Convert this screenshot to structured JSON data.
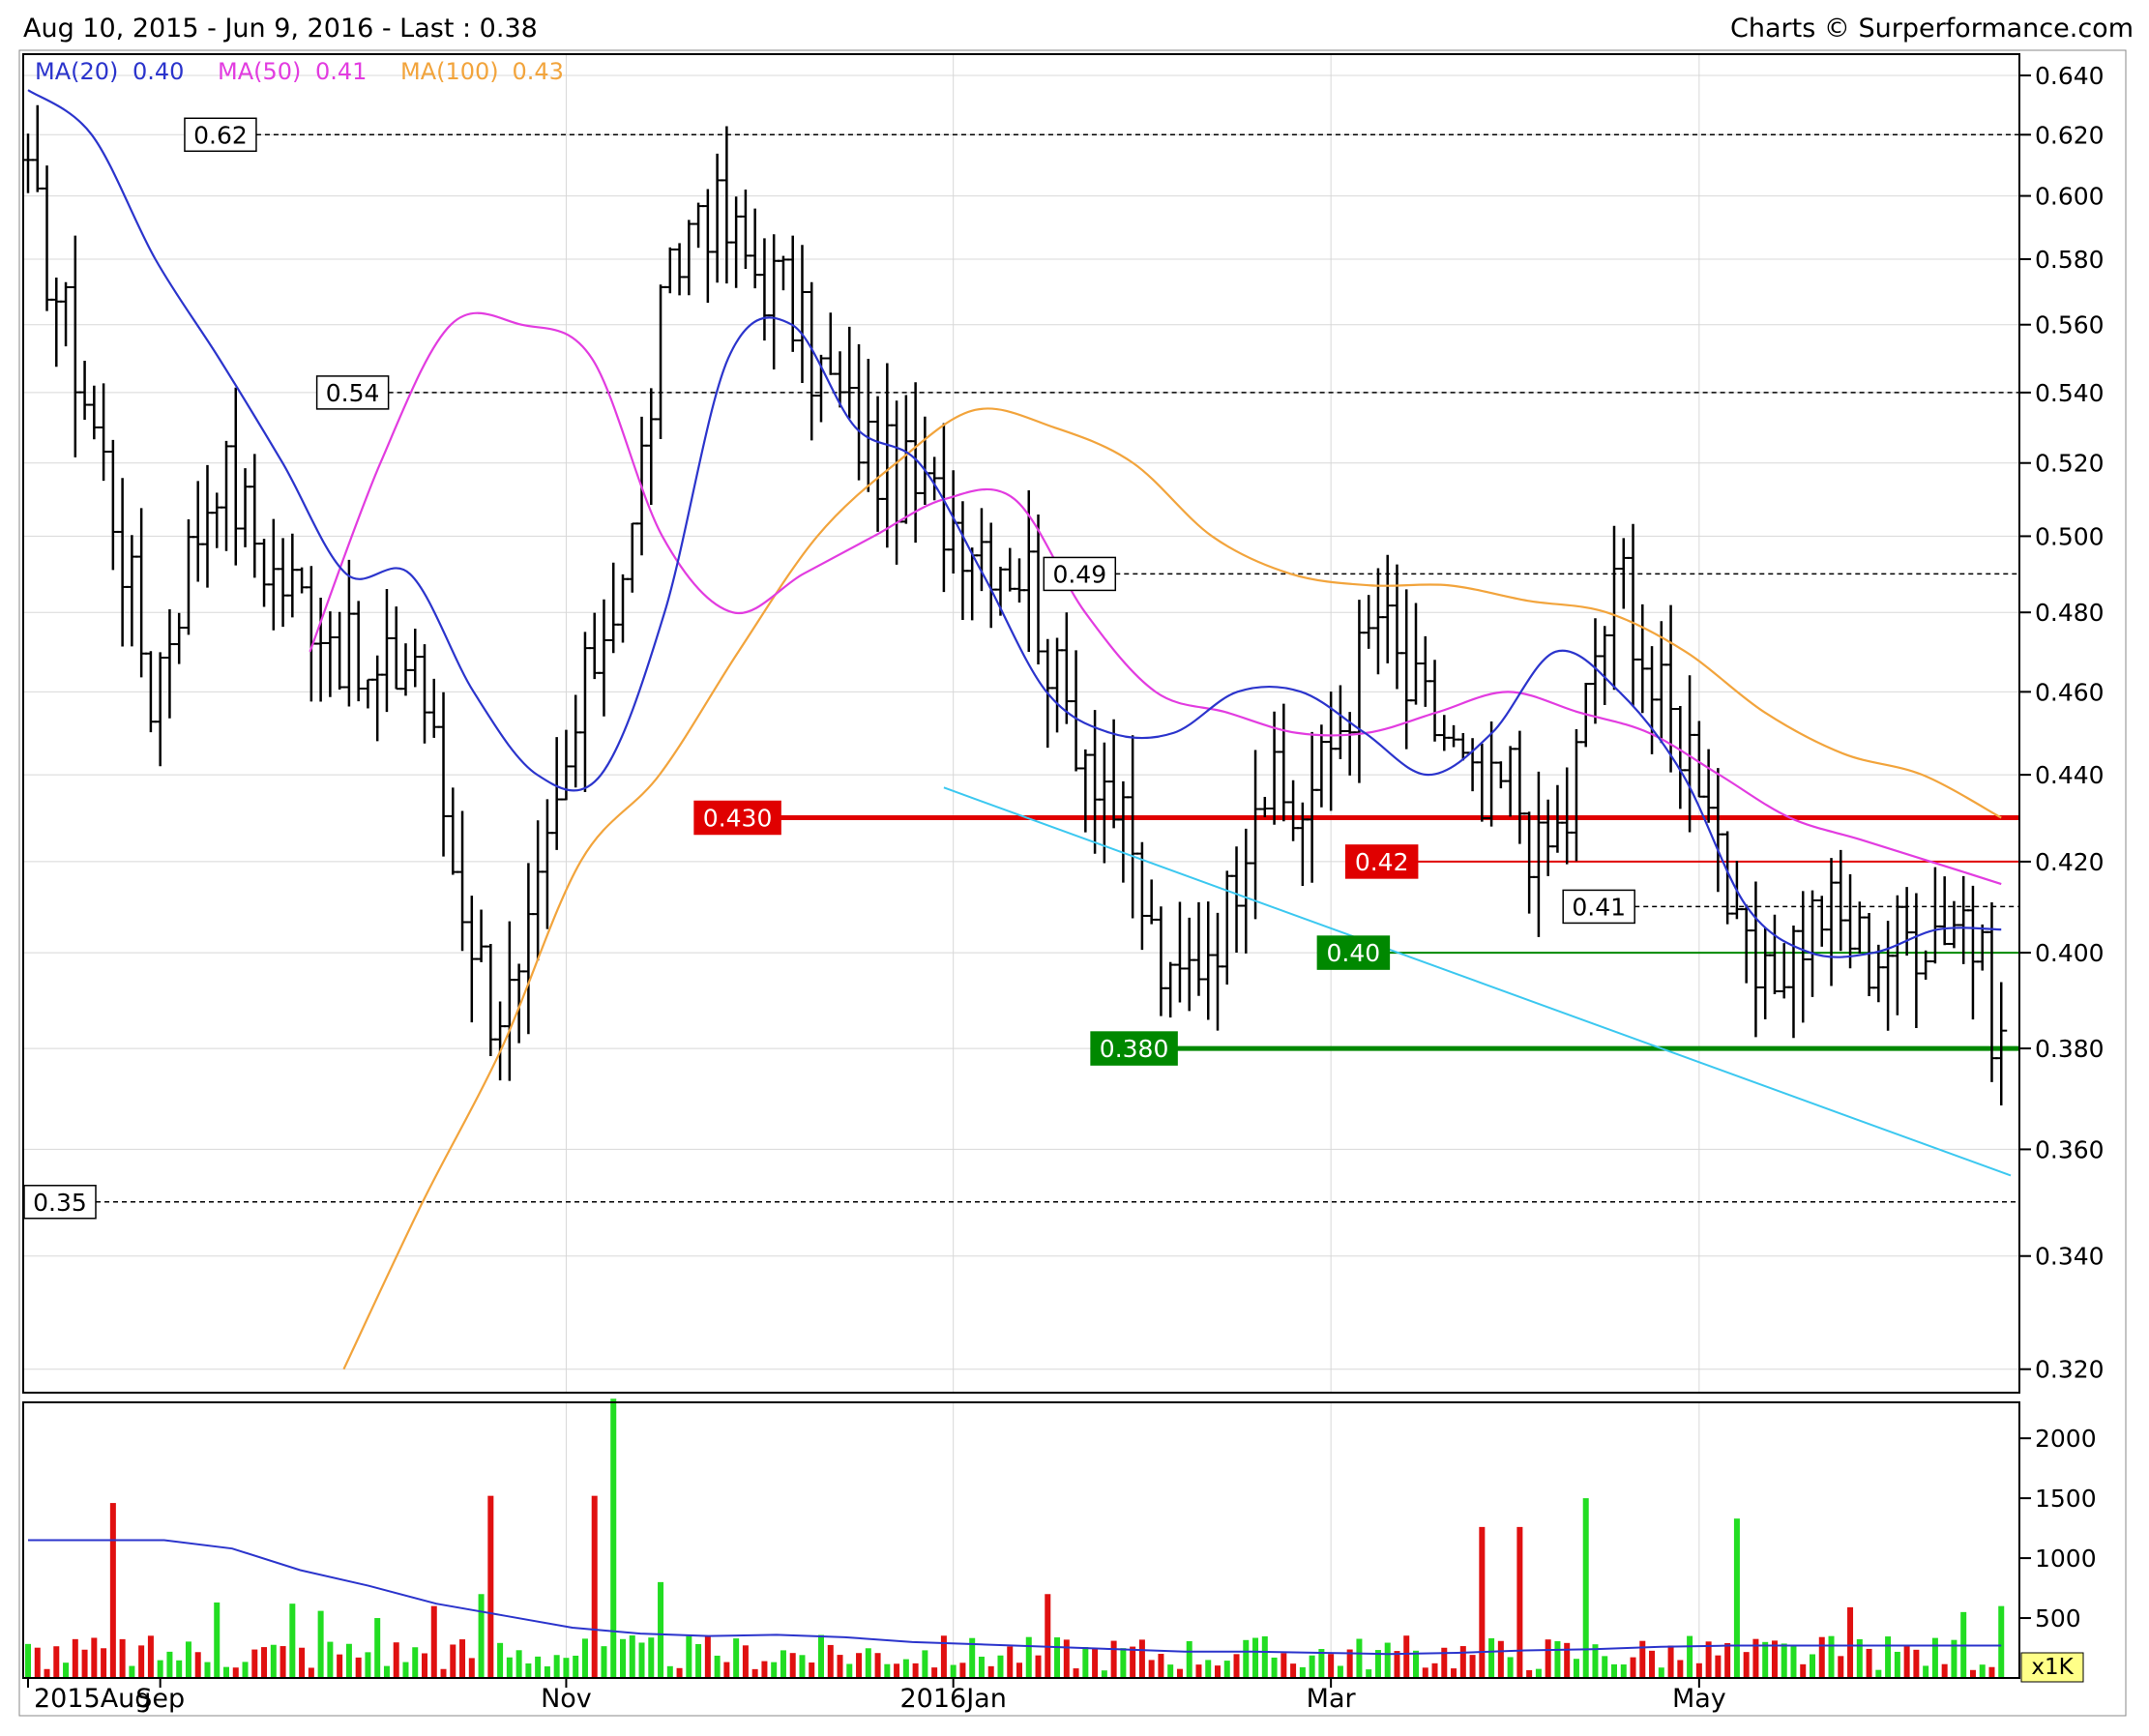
{
  "header": {
    "range_text": "Aug 10, 2015 - Jun 9, 2016 - Last : 0.38",
    "credit_text": "Charts © Surperformance.com"
  },
  "legend": [
    {
      "label": "MA(20)",
      "value": "0.40",
      "color": "#2b34cc"
    },
    {
      "label": "MA(50)",
      "value": "0.41",
      "color": "#e23ce0"
    },
    {
      "label": "MA(100)",
      "value": "0.43",
      "color": "#f2a43c"
    }
  ],
  "colors": {
    "bars": "#000000",
    "support": "#008800",
    "resistance": "#e00000",
    "trendline": "#3cc8f0",
    "vol_up": "#22dd22",
    "vol_down": "#e01010",
    "vol_ma": "#2b34cc",
    "grid": "#d8d8d8",
    "dashed": "#000000"
  },
  "chart_data": [
    {
      "type": "ohlc",
      "panel": "price",
      "x_tick_labels": [
        "2015Aug",
        "Sep",
        "Nov",
        "2016Jan",
        "Mar",
        "May"
      ],
      "y_tick_labels": [
        "0.640",
        "0.620",
        "0.600",
        "0.580",
        "0.560",
        "0.540",
        "0.520",
        "0.500",
        "0.480",
        "0.460",
        "0.440",
        "0.420",
        "0.400",
        "0.380",
        "0.360",
        "0.340",
        "0.320"
      ],
      "y_scale": "log",
      "ylim": [
        0.316,
        0.646
      ],
      "n_sessions": 210,
      "anchors": [
        [
          0,
          0.6
        ],
        [
          8,
          0.52
        ],
        [
          13,
          0.46
        ],
        [
          20,
          0.52
        ],
        [
          26,
          0.49
        ],
        [
          31,
          0.48
        ],
        [
          36,
          0.46
        ],
        [
          41,
          0.47
        ],
        [
          45,
          0.42
        ],
        [
          49,
          0.39
        ],
        [
          52,
          0.39
        ],
        [
          56,
          0.43
        ],
        [
          60,
          0.47
        ],
        [
          64,
          0.5
        ],
        [
          67,
          0.56
        ],
        [
          71,
          0.6
        ],
        [
          76,
          0.58
        ],
        [
          80,
          0.57
        ],
        [
          83,
          0.55
        ],
        [
          90,
          0.52
        ],
        [
          95,
          0.51
        ],
        [
          101,
          0.5
        ],
        [
          106,
          0.49
        ],
        [
          109,
          0.46
        ],
        [
          114,
          0.44
        ],
        [
          118,
          0.41
        ],
        [
          121,
          0.39
        ],
        [
          127,
          0.41
        ],
        [
          130,
          0.44
        ],
        [
          134,
          0.43
        ],
        [
          137,
          0.44
        ],
        [
          140,
          0.46
        ],
        [
          143,
          0.48
        ],
        [
          146,
          0.46
        ],
        [
          150,
          0.45
        ],
        [
          154,
          0.43
        ],
        [
          157,
          0.44
        ],
        [
          160,
          0.42
        ],
        [
          163,
          0.43
        ],
        [
          166,
          0.47
        ],
        [
          169,
          0.49
        ],
        [
          172,
          0.46
        ],
        [
          175,
          0.45
        ],
        [
          178,
          0.44
        ],
        [
          181,
          0.4
        ],
        [
          184,
          0.39
        ],
        [
          186,
          0.4
        ],
        [
          190,
          0.41
        ],
        [
          195,
          0.4
        ],
        [
          200,
          0.405
        ],
        [
          205,
          0.41
        ],
        [
          209,
          0.38
        ]
      ],
      "ma20": [
        0.635,
        0.62,
        0.58,
        0.55,
        0.52,
        0.49,
        0.49,
        0.46,
        0.44,
        0.44,
        0.48,
        0.55,
        0.56,
        0.53,
        0.52,
        0.49,
        0.46,
        0.45,
        0.45,
        0.46,
        0.46,
        0.45,
        0.44,
        0.45,
        0.47,
        0.46,
        0.44,
        0.41,
        0.4,
        0.4,
        0.405,
        0.405
      ],
      "ma50": [
        null,
        null,
        null,
        null,
        0.47,
        0.52,
        0.56,
        0.56,
        0.55,
        0.5,
        0.48,
        0.49,
        0.5,
        0.51,
        0.51,
        0.48,
        0.46,
        0.455,
        0.45,
        0.45,
        0.455,
        0.46,
        0.455,
        0.45,
        0.44,
        0.43,
        0.425,
        0.42,
        0.415
      ],
      "ma100": [
        null,
        null,
        null,
        null,
        0.32,
        0.35,
        0.38,
        0.42,
        0.44,
        0.47,
        0.5,
        0.52,
        0.535,
        0.53,
        0.52,
        0.5,
        0.49,
        0.487,
        0.487,
        0.483,
        0.48,
        0.47,
        0.455,
        0.445,
        0.44,
        0.43
      ],
      "levels": [
        {
          "label": "0.62",
          "value": 0.62,
          "style": "dashed",
          "box_session": 17
        },
        {
          "label": "0.54",
          "value": 0.54,
          "style": "dashed",
          "box_session": 31
        },
        {
          "label": "0.49",
          "value": 0.49,
          "style": "dashed",
          "box_session": 108
        },
        {
          "label": "0.41",
          "value": 0.41,
          "style": "dashed",
          "box_session": 163
        },
        {
          "label": "0.35",
          "value": 0.35,
          "style": "dashed",
          "box_session": 0
        },
        {
          "label": "0.430",
          "value": 0.43,
          "style": "resistance-thick",
          "box_session": 71
        },
        {
          "label": "0.42",
          "value": 0.42,
          "style": "resistance",
          "box_session": 140
        },
        {
          "label": "0.40",
          "value": 0.4,
          "style": "support",
          "box_session": 137
        },
        {
          "label": "0.380",
          "value": 0.38,
          "style": "support-thick",
          "box_session": 113
        }
      ],
      "trendline": {
        "from": [
          97,
          0.437
        ],
        "to": [
          210,
          0.355
        ]
      }
    },
    {
      "type": "bar",
      "panel": "volume",
      "y_tick_labels": [
        "2000",
        "1500",
        "1000",
        "500"
      ],
      "unit_label": "x1K",
      "ylim": [
        0,
        2300
      ],
      "spikes": [
        [
          9,
          1460
        ],
        [
          20,
          630
        ],
        [
          28,
          620
        ],
        [
          31,
          560
        ],
        [
          37,
          500
        ],
        [
          43,
          600
        ],
        [
          48,
          700
        ],
        [
          49,
          1520
        ],
        [
          60,
          1520
        ],
        [
          62,
          2330
        ],
        [
          67,
          800
        ],
        [
          108,
          700
        ],
        [
          154,
          1260
        ],
        [
          158,
          1260
        ],
        [
          165,
          1500
        ],
        [
          181,
          1330
        ],
        [
          193,
          590
        ],
        [
          205,
          550
        ],
        [
          209,
          600
        ]
      ],
      "vol_ma": [
        1150,
        1150,
        1150,
        1080,
        900,
        770,
        620,
        520,
        420,
        370,
        350,
        360,
        340,
        300,
        280,
        260,
        240,
        220,
        220,
        210,
        200,
        210,
        230,
        240,
        260,
        270,
        270,
        270,
        270,
        270
      ]
    }
  ]
}
